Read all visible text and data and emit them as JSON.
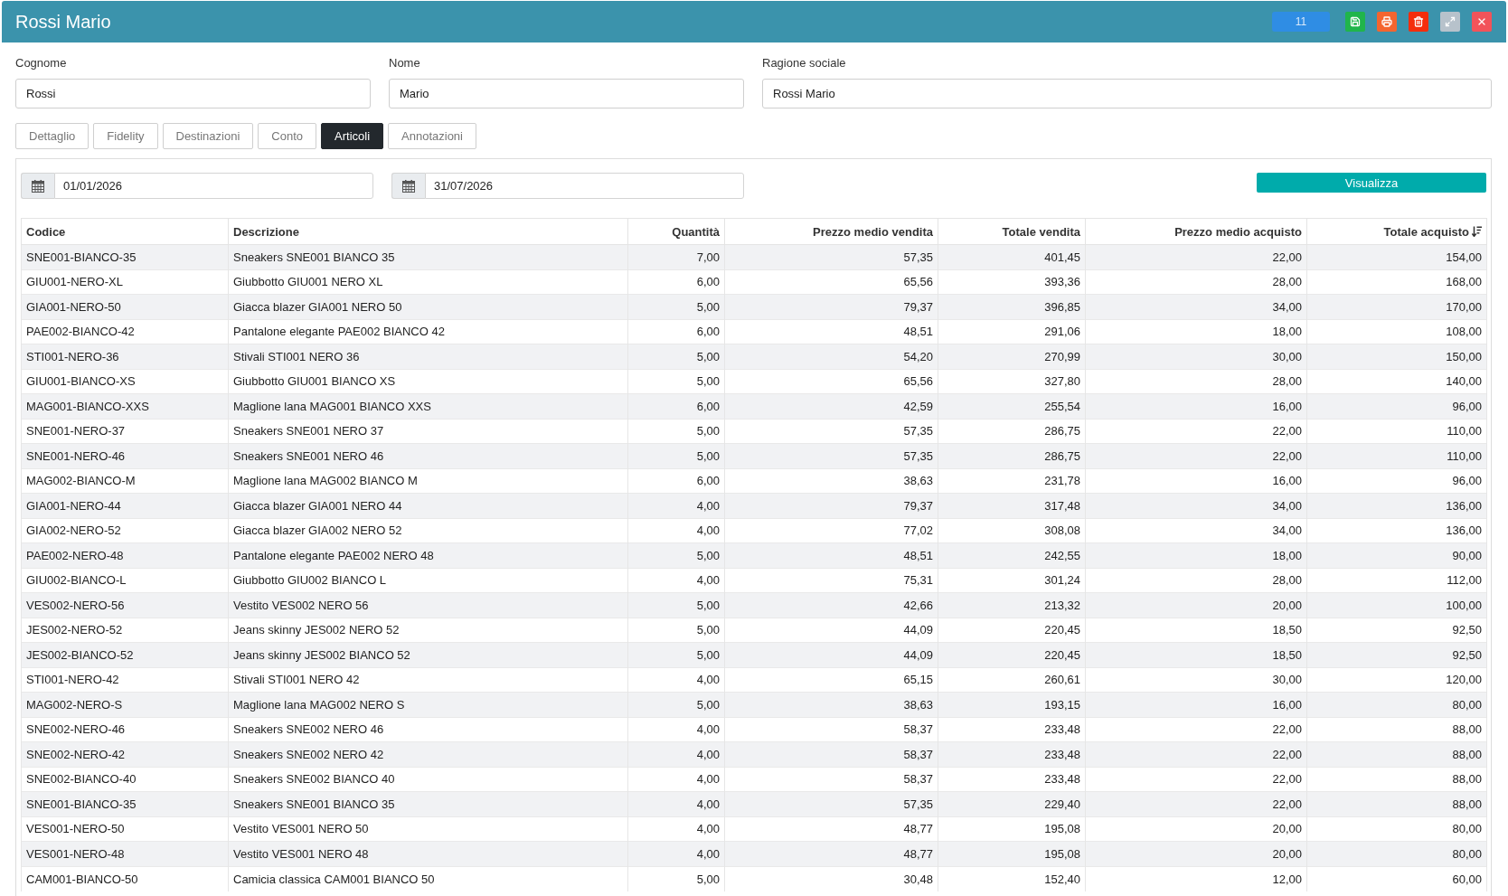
{
  "window": {
    "title": "Rossi Mario"
  },
  "toolbar": {
    "counter": "11"
  },
  "fields": [
    {
      "label": "Cognome",
      "value": "Rossi"
    },
    {
      "label": "Nome",
      "value": "Mario"
    },
    {
      "label": "Ragione sociale",
      "value": "Rossi Mario"
    }
  ],
  "tabs": [
    {
      "label": "Dettaglio",
      "selected": false
    },
    {
      "label": "Fidelity",
      "selected": false
    },
    {
      "label": "Destinazioni",
      "selected": false
    },
    {
      "label": "Conto",
      "selected": false
    },
    {
      "label": "Articoli",
      "selected": true
    },
    {
      "label": "Annotazioni",
      "selected": false
    }
  ],
  "filters": {
    "date_from": "01/01/2026",
    "date_to": "31/07/2026",
    "submit": "Visualizza"
  },
  "table": {
    "columns": [
      {
        "label": "Codice",
        "sorted": false
      },
      {
        "label": "Descrizione",
        "sorted": false
      },
      {
        "label": "Quantità",
        "sorted": false
      },
      {
        "label": "Prezzo medio vendita",
        "sorted": false
      },
      {
        "label": "Totale vendita",
        "sorted": false
      },
      {
        "label": "Prezzo medio acquisto",
        "sorted": false
      },
      {
        "label": "Totale acquisto",
        "sorted": true
      }
    ],
    "rows": [
      [
        "SNE001-BIANCO-35",
        "Sneakers SNE001 BIANCO 35",
        "7,00",
        "57,35",
        "401,45",
        "22,00",
        "154,00"
      ],
      [
        "GIU001-NERO-XL",
        "Giubbotto GIU001 NERO XL",
        "6,00",
        "65,56",
        "393,36",
        "28,00",
        "168,00"
      ],
      [
        "GIA001-NERO-50",
        "Giacca blazer GIA001 NERO 50",
        "5,00",
        "79,37",
        "396,85",
        "34,00",
        "170,00"
      ],
      [
        "PAE002-BIANCO-42",
        "Pantalone elegante PAE002 BIANCO 42",
        "6,00",
        "48,51",
        "291,06",
        "18,00",
        "108,00"
      ],
      [
        "STI001-NERO-36",
        "Stivali STI001 NERO 36",
        "5,00",
        "54,20",
        "270,99",
        "30,00",
        "150,00"
      ],
      [
        "GIU001-BIANCO-XS",
        "Giubbotto GIU001 BIANCO XS",
        "5,00",
        "65,56",
        "327,80",
        "28,00",
        "140,00"
      ],
      [
        "MAG001-BIANCO-XXS",
        "Maglione lana MAG001 BIANCO XXS",
        "6,00",
        "42,59",
        "255,54",
        "16,00",
        "96,00"
      ],
      [
        "SNE001-NERO-37",
        "Sneakers SNE001 NERO 37",
        "5,00",
        "57,35",
        "286,75",
        "22,00",
        "110,00"
      ],
      [
        "SNE001-NERO-46",
        "Sneakers SNE001 NERO 46",
        "5,00",
        "57,35",
        "286,75",
        "22,00",
        "110,00"
      ],
      [
        "MAG002-BIANCO-M",
        "Maglione lana MAG002 BIANCO M",
        "6,00",
        "38,63",
        "231,78",
        "16,00",
        "96,00"
      ],
      [
        "GIA001-NERO-44",
        "Giacca blazer GIA001 NERO 44",
        "4,00",
        "79,37",
        "317,48",
        "34,00",
        "136,00"
      ],
      [
        "GIA002-NERO-52",
        "Giacca blazer GIA002 NERO 52",
        "4,00",
        "77,02",
        "308,08",
        "34,00",
        "136,00"
      ],
      [
        "PAE002-NERO-48",
        "Pantalone elegante PAE002 NERO 48",
        "5,00",
        "48,51",
        "242,55",
        "18,00",
        "90,00"
      ],
      [
        "GIU002-BIANCO-L",
        "Giubbotto GIU002 BIANCO L",
        "4,00",
        "75,31",
        "301,24",
        "28,00",
        "112,00"
      ],
      [
        "VES002-NERO-56",
        "Vestito VES002 NERO 56",
        "5,00",
        "42,66",
        "213,32",
        "20,00",
        "100,00"
      ],
      [
        "JES002-NERO-52",
        "Jeans skinny JES002 NERO 52",
        "5,00",
        "44,09",
        "220,45",
        "18,50",
        "92,50"
      ],
      [
        "JES002-BIANCO-52",
        "Jeans skinny JES002 BIANCO 52",
        "5,00",
        "44,09",
        "220,45",
        "18,50",
        "92,50"
      ],
      [
        "STI001-NERO-42",
        "Stivali STI001 NERO 42",
        "4,00",
        "65,15",
        "260,61",
        "30,00",
        "120,00"
      ],
      [
        "MAG002-NERO-S",
        "Maglione lana MAG002 NERO S",
        "5,00",
        "38,63",
        "193,15",
        "16,00",
        "80,00"
      ],
      [
        "SNE002-NERO-46",
        "Sneakers SNE002 NERO 46",
        "4,00",
        "58,37",
        "233,48",
        "22,00",
        "88,00"
      ],
      [
        "SNE002-NERO-42",
        "Sneakers SNE002 NERO 42",
        "4,00",
        "58,37",
        "233,48",
        "22,00",
        "88,00"
      ],
      [
        "SNE002-BIANCO-40",
        "Sneakers SNE002 BIANCO 40",
        "4,00",
        "58,37",
        "233,48",
        "22,00",
        "88,00"
      ],
      [
        "SNE001-BIANCO-35",
        "Sneakers SNE001 BIANCO 35",
        "4,00",
        "57,35",
        "229,40",
        "22,00",
        "88,00"
      ],
      [
        "VES001-NERO-50",
        "Vestito VES001 NERO 50",
        "4,00",
        "48,77",
        "195,08",
        "20,00",
        "80,00"
      ],
      [
        "VES001-NERO-48",
        "Vestito VES001 NERO 48",
        "4,00",
        "48,77",
        "195,08",
        "20,00",
        "80,00"
      ],
      [
        "CAM001-BIANCO-50",
        "Camicia classica CAM001 BIANCO 50",
        "5,00",
        "30,48",
        "152,40",
        "12,00",
        "60,00"
      ]
    ]
  }
}
